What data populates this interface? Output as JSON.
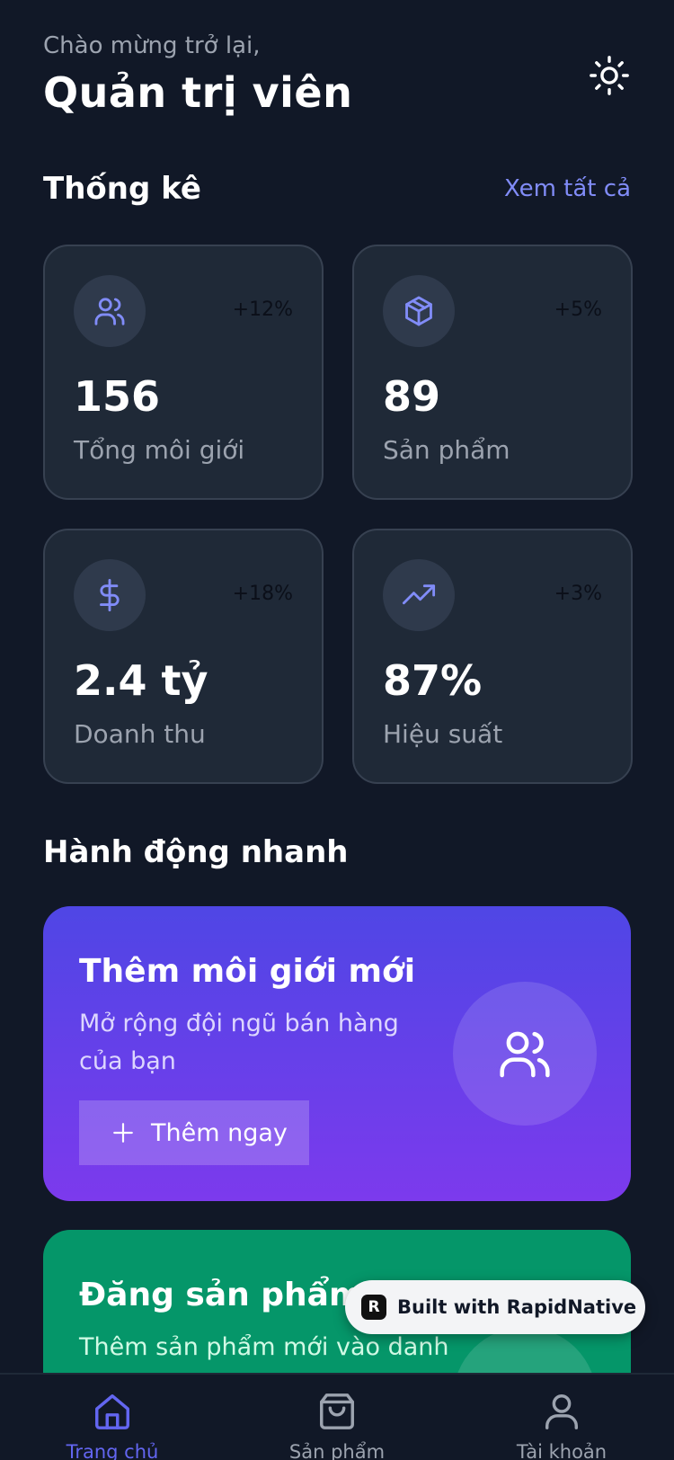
{
  "header": {
    "greeting": "Chào mừng trở lại,",
    "title": "Quản trị viên",
    "theme_icon": "sun-icon"
  },
  "stats": {
    "title": "Thống kê",
    "see_all": "Xem tất cả",
    "cards": [
      {
        "icon": "users-icon",
        "change": "+12%",
        "value": "156",
        "label": "Tổng môi giới"
      },
      {
        "icon": "package-icon",
        "change": "+5%",
        "value": "89",
        "label": "Sản phẩm"
      },
      {
        "icon": "dollar-icon",
        "change": "+18%",
        "value": "2.4 tỷ",
        "label": "Doanh thu"
      },
      {
        "icon": "trending-up-icon",
        "change": "+3%",
        "value": "87%",
        "label": "Hiệu suất"
      }
    ]
  },
  "quick_actions": {
    "title": "Hành động nhanh",
    "cards": [
      {
        "title": "Thêm môi giới mới",
        "description": "Mở rộng đội ngũ bán hàng của bạn",
        "button_label": "Thêm ngay",
        "icon": "users-icon",
        "color_from": "#4f46e5",
        "color_to": "#7c3aed"
      },
      {
        "title": "Đăng sản phẩm",
        "description": "Thêm sản phẩm mới vào danh",
        "icon": "package-icon",
        "color": "#059669"
      }
    ]
  },
  "badge": {
    "text": "Built with RapidNative",
    "logo": "R"
  },
  "bottom_nav": {
    "items": [
      {
        "label": "Trang chủ",
        "icon": "home-icon",
        "active": true
      },
      {
        "label": "Sản phẩm",
        "icon": "shopping-bag-icon",
        "active": false
      },
      {
        "label": "Tài khoản",
        "icon": "user-icon",
        "active": false
      }
    ]
  },
  "colors": {
    "background": "#111827",
    "card": "#1f2937",
    "accent": "#818cf8",
    "active_nav": "#6366f1"
  }
}
